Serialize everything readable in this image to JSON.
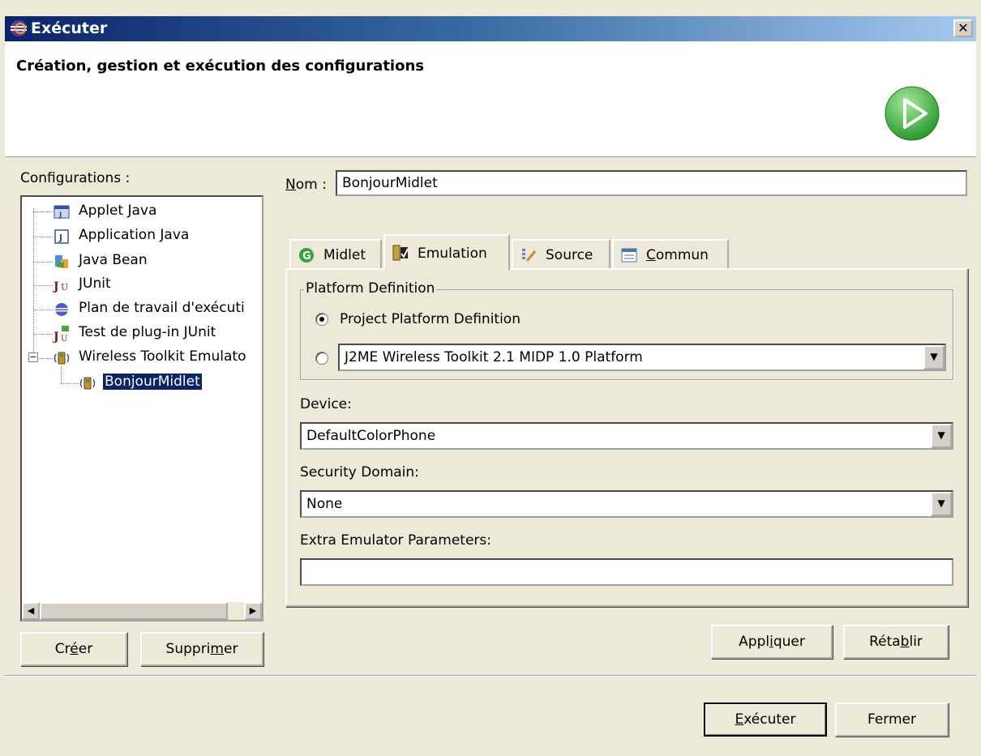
{
  "window": {
    "title": "Exécuter",
    "close_label": "✕",
    "banner_title": "Création, gestion et exécution des configurations"
  },
  "left": {
    "configurations_label": "Configurations :",
    "tree": [
      {
        "label": "Applet Java",
        "icon": "applet-icon"
      },
      {
        "label": "Application Java",
        "icon": "java-app-icon"
      },
      {
        "label": "Java Bean",
        "icon": "java-bean-icon"
      },
      {
        "label": "JUnit",
        "icon": "junit-icon"
      },
      {
        "label": "Plan de travail d'exécuti",
        "icon": "workbench-icon"
      },
      {
        "label": "Test de plug-in JUnit",
        "icon": "plugin-junit-icon"
      },
      {
        "label": "Wireless Toolkit Emulato",
        "icon": "wireless-toolkit-icon"
      },
      {
        "label": "BonjourMidlet",
        "icon": "midlet-icon",
        "selected": true
      }
    ],
    "create_pre": "Cr",
    "create_key": "é",
    "create_post": "er",
    "delete_pre": "Suppri",
    "delete_key": "m",
    "delete_post": "er"
  },
  "right": {
    "name_key": "N",
    "name_post": "om :",
    "name_value": "BonjourMidlet",
    "tabs": [
      {
        "label": "Midlet",
        "icon": "midlet-tab-icon"
      },
      {
        "label": "Emulation",
        "icon": "emulation-tab-icon",
        "active": true
      },
      {
        "label": "Source",
        "icon": "source-tab-icon"
      },
      {
        "label_key": "C",
        "label_post": "ommun",
        "icon": "common-tab-icon"
      }
    ],
    "platform": {
      "legend": "Platform Definition",
      "option_project": "Project Platform Definition",
      "option_toolkit_value": "J2ME Wireless Toolkit 2.1 MIDP 1.0 Platform",
      "selected": "project"
    },
    "device_label": "Device:",
    "device_value": "DefaultColorPhone",
    "security_label": "Security Domain:",
    "security_value": "None",
    "extra_label": "Extra Emulator Parameters:",
    "extra_value": "",
    "apply_pre": "Appl",
    "apply_key": "i",
    "apply_post": "quer",
    "revert_pre": "Réta",
    "revert_key": "b",
    "revert_post": "lir"
  },
  "footer": {
    "run_key": "E",
    "run_post": "xécuter",
    "close_label": "Fermer"
  },
  "colors": {
    "titlebar": "#0a246a",
    "face": "#ece9d8",
    "selection": "#0a246a",
    "run_icon": "#3cb044"
  }
}
